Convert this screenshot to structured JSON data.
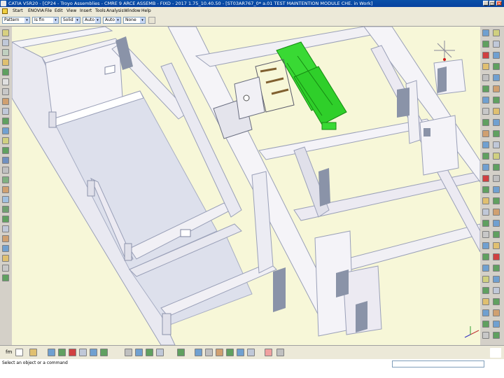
{
  "window": {
    "title": "CATIA V5R20 - [CP24 - Troyo Assemblies - CMRE 9 ARCE ASSEMB - FIXD - 2017 1.75_10.40.50 - [ST03AR767_0* a.01 TEST MAINTENTION MODULE CHE. in Work]",
    "btn_min": "_",
    "btn_max": "□",
    "btn_close": "×"
  },
  "menubar": {
    "items": [
      "Start",
      "ENOVIA",
      "File",
      "Edit",
      "View",
      "Insert",
      "Tools",
      "Analysis",
      "Window",
      "Help"
    ]
  },
  "formatbar": {
    "font_name": "Pattern",
    "font_size": "Is fin",
    "style": "Solid",
    "thickness": "Auto",
    "color": "Auto",
    "layer": "None"
  },
  "status": {
    "message": "Select an object or a command"
  },
  "colors": {
    "viewport_bg": "#f7f7d8",
    "wall_fill": "#f1f0f5",
    "wall_dark": "#b3b8cc",
    "floor": "#d7dbe8",
    "door": "#8a93a8",
    "equipment_green": "#39d934",
    "compass_red": "#d01a1a"
  },
  "icons": {
    "compass": "compass-icon",
    "axis": "axis-triad-icon",
    "catia_logo": "catia-logo-icon"
  }
}
